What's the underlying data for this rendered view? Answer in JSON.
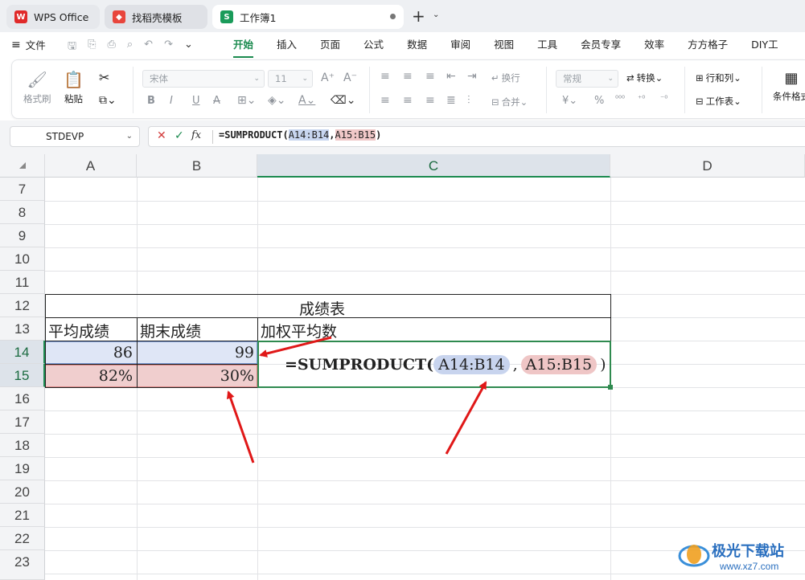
{
  "tabs": [
    {
      "label": "WPS Office"
    },
    {
      "label": "找稻壳模板"
    },
    {
      "label": "工作簿1",
      "icon_text": "S"
    }
  ],
  "menu": {
    "file_label": "文件",
    "items": [
      "开始",
      "插入",
      "页面",
      "公式",
      "数据",
      "审阅",
      "视图",
      "工具",
      "会员专享",
      "效率",
      "方方格子",
      "DIY工"
    ],
    "active": "开始"
  },
  "ribbon": {
    "format_painter": "格式刷",
    "paste": "粘贴",
    "font_name": "宋体",
    "font_size": "11",
    "wrap": "换行",
    "merge": "合并",
    "number_format": "常规",
    "convert": "转换",
    "row_col": "行和列",
    "worksheet": "工作表",
    "conditional": "条件格式",
    "currency_symbol": "¥",
    "percent_symbol": "%"
  },
  "formula_bar": {
    "name_box": "STDEVP",
    "prefix": "=SUMPRODUCT(",
    "ref1": "A14:B14",
    "sep": ",",
    "ref2": "A15:B15",
    "suffix": ")"
  },
  "grid": {
    "columns": [
      "A",
      "B",
      "C",
      "D"
    ],
    "rows": [
      "7",
      "8",
      "9",
      "10",
      "11",
      "12",
      "13",
      "14",
      "15",
      "16",
      "17",
      "18",
      "19",
      "20",
      "21",
      "22",
      "23"
    ],
    "selected_column": "C",
    "selected_rows": [
      "14",
      "15"
    ]
  },
  "table": {
    "title": "成绩表",
    "headers": [
      "平均成绩",
      "期末成绩",
      "加权平均数"
    ],
    "row14": [
      "86",
      "99"
    ],
    "row15": [
      "82%",
      "30%"
    ],
    "formula_prefix": "=SUMPRODUCT(",
    "formula_ref1": "A14:B14",
    "formula_sep": ",",
    "formula_ref2": "A15:B15",
    "formula_suffix": ")"
  },
  "watermark": {
    "text": "极光下载站",
    "url": "www.xz7.com"
  },
  "colors": {
    "accent": "#1b8a4f",
    "ref_blue": "#c8d6f0",
    "ref_red": "#f0c8c8",
    "arrow": "#e01818"
  }
}
